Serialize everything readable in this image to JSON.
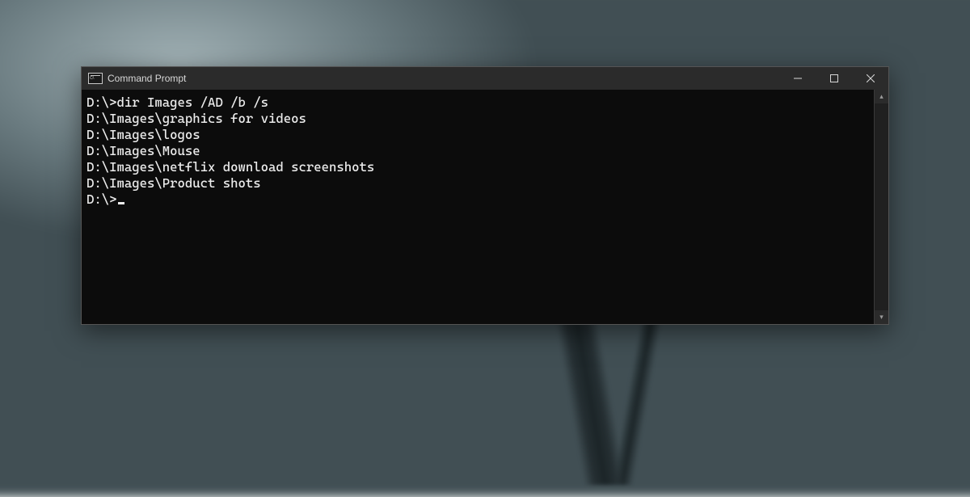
{
  "window": {
    "title": "Command Prompt"
  },
  "terminal": {
    "lines": [
      "D:\\>dir Images /AD /b /s",
      "D:\\Images\\graphics for videos",
      "D:\\Images\\logos",
      "D:\\Images\\Mouse",
      "D:\\Images\\netflix download screenshots",
      "D:\\Images\\Product shots",
      "",
      "D:\\>"
    ],
    "cursor_after_last": true
  }
}
